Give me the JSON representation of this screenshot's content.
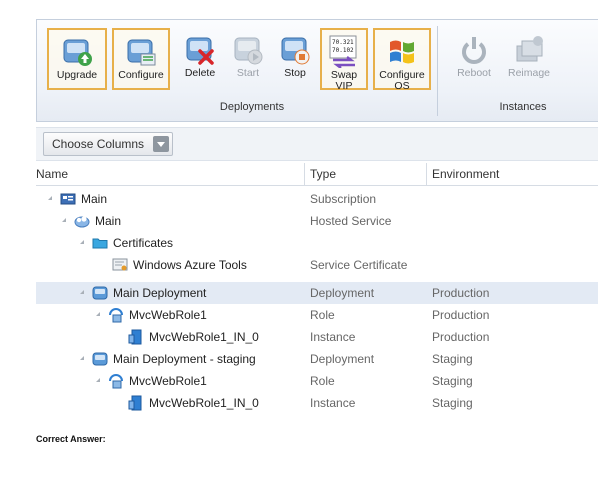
{
  "ribbon": {
    "buttons": [
      {
        "label": "Upgrade",
        "icon": "upgrade-icon",
        "highlighted": true,
        "enabled": true
      },
      {
        "label": "Configure",
        "icon": "configure-icon",
        "highlighted": true,
        "enabled": true
      },
      {
        "label": "Delete",
        "icon": "delete-icon",
        "highlighted": false,
        "enabled": true
      },
      {
        "label": "Start",
        "icon": "start-icon",
        "highlighted": false,
        "enabled": false
      },
      {
        "label": "Stop",
        "icon": "stop-icon",
        "highlighted": false,
        "enabled": true
      },
      {
        "label": "Swap VIP",
        "icon": "swap-vip-icon",
        "highlighted": true,
        "enabled": true
      },
      {
        "label": "Configure OS",
        "icon": "configure-os-icon",
        "highlighted": true,
        "enabled": true
      },
      {
        "label": "Reboot",
        "icon": "reboot-icon",
        "highlighted": false,
        "enabled": false
      },
      {
        "label": "Reimage",
        "icon": "reimage-icon",
        "highlighted": false,
        "enabled": false
      }
    ],
    "swap_vip_icon_text": [
      "70.321",
      "70.102"
    ],
    "groups": {
      "deployments": "Deployments",
      "instances": "Instances"
    }
  },
  "toolbar": {
    "choose_columns": "Choose Columns"
  },
  "table": {
    "headers": {
      "name": "Name",
      "type": "Type",
      "environment": "Environment"
    },
    "rows": [
      {
        "name": "Main",
        "type": "Subscription",
        "environment": "",
        "icon": "subscription-icon"
      },
      {
        "name": "Main",
        "type": "Hosted Service",
        "environment": "",
        "icon": "hosted-service-icon"
      },
      {
        "name": "Certificates",
        "type": "",
        "environment": "",
        "icon": "folder-icon"
      },
      {
        "name": "Windows Azure Tools",
        "type": "Service Certificate",
        "environment": "",
        "icon": "certificate-icon"
      },
      {
        "name": "Main Deployment",
        "type": "Deployment",
        "environment": "Production",
        "icon": "deployment-icon",
        "selected": true
      },
      {
        "name": "MvcWebRole1",
        "type": "Role",
        "environment": "Production",
        "icon": "role-icon"
      },
      {
        "name": "MvcWebRole1_IN_0",
        "type": "Instance",
        "environment": "Production",
        "icon": "instance-icon"
      },
      {
        "name": "Main Deployment - staging",
        "type": "Deployment",
        "environment": "Staging",
        "icon": "deployment-icon"
      },
      {
        "name": "MvcWebRole1",
        "type": "Role",
        "environment": "Staging",
        "icon": "role-icon"
      },
      {
        "name": "MvcWebRole1_IN_0",
        "type": "Instance",
        "environment": "Staging",
        "icon": "instance-icon"
      }
    ]
  },
  "footer": {
    "correct_answer": "Correct Answer:"
  }
}
